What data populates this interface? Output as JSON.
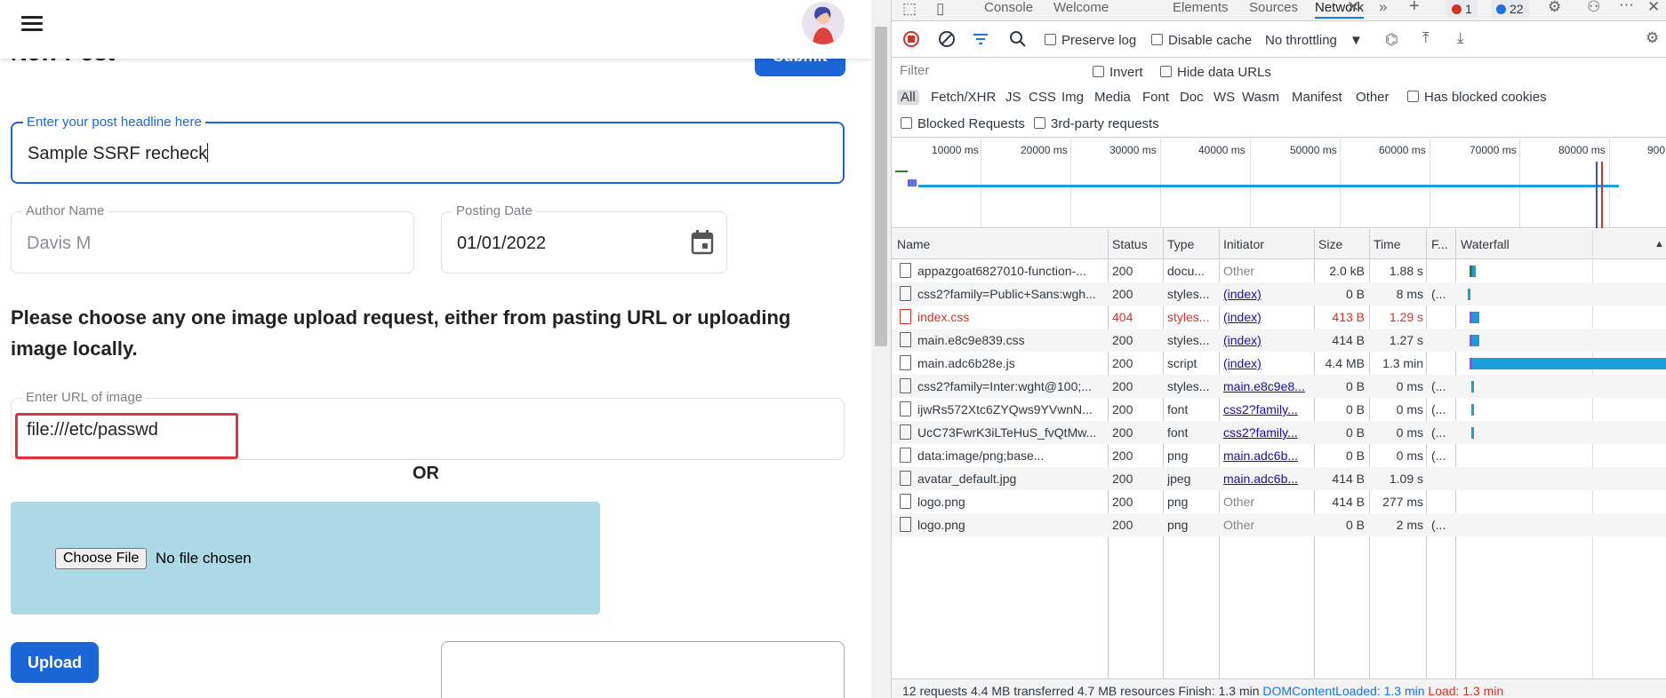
{
  "app": {
    "partial_heading": "New Post",
    "submit_label": "Submit",
    "headline": {
      "label": "Enter your post headline here",
      "value": "Sample SSRF recheck"
    },
    "author": {
      "label": "Author Name",
      "value": "Davis M"
    },
    "date": {
      "label": "Posting Date",
      "value": "01/01/2022"
    },
    "instruction": "Please choose any one image upload request, either from pasting URL or uploading image locally.",
    "url_field": {
      "label": "Enter URL of image",
      "value": "file:///etc/passwd"
    },
    "or_label": "OR",
    "file": {
      "button": "Choose File",
      "status": "No file chosen"
    },
    "upload_label": "Upload",
    "colors": {
      "primary": "#1b67d8",
      "drop_zone": "#add8e6",
      "highlight": "#d9363e"
    }
  },
  "devtools": {
    "tabs": [
      "Console",
      "Welcome",
      "Elements",
      "Sources",
      "Network"
    ],
    "active_tab": "Network",
    "error_count": "1",
    "message_count": "22",
    "toolbar": {
      "preserve_log": "Preserve log",
      "disable_cache": "Disable cache",
      "throttling": "No throttling"
    },
    "filter": {
      "placeholder": "Filter",
      "invert": "Invert",
      "hide_data_urls": "Hide data URLs",
      "types": [
        "All",
        "Fetch/XHR",
        "JS",
        "CSS",
        "Img",
        "Media",
        "Font",
        "Doc",
        "WS",
        "Wasm",
        "Manifest",
        "Other"
      ],
      "has_blocked_cookies": "Has blocked cookies",
      "blocked_requests": "Blocked Requests",
      "third_party": "3rd-party requests"
    },
    "timeline_ticks": [
      "10000 ms",
      "20000 ms",
      "30000 ms",
      "40000 ms",
      "50000 ms",
      "60000 ms",
      "70000 ms",
      "80000 ms",
      "900"
    ],
    "columns": [
      "Name",
      "Status",
      "Type",
      "Initiator",
      "Size",
      "Time",
      "F...",
      "Waterfall"
    ],
    "rows": [
      {
        "name": "appazgoat6827010-function-...",
        "status": "200",
        "type": "docu...",
        "initiator": "Other",
        "size": "2.0 kB",
        "time": "1.88 s",
        "fulfilled": ""
      },
      {
        "name": "css2?family=Public+Sans:wgh...",
        "status": "200",
        "type": "styles...",
        "initiator": "(index)",
        "size": "0 B",
        "time": "8 ms",
        "fulfilled": "(..."
      },
      {
        "name": "index.css",
        "status": "404",
        "type": "styles...",
        "initiator": "(index)",
        "size": "413 B",
        "time": "1.29 s",
        "fulfilled": ""
      },
      {
        "name": "main.e8c9e839.css",
        "status": "200",
        "type": "styles...",
        "initiator": "(index)",
        "size": "414 B",
        "time": "1.27 s",
        "fulfilled": ""
      },
      {
        "name": "main.adc6b28e.js",
        "status": "200",
        "type": "script",
        "initiator": "(index)",
        "size": "4.4 MB",
        "time": "1.3 min",
        "fulfilled": ""
      },
      {
        "name": "css2?family=Inter:wght@100;...",
        "status": "200",
        "type": "styles...",
        "initiator": "main.e8c9e8...",
        "size": "0 B",
        "time": "0 ms",
        "fulfilled": "(..."
      },
      {
        "name": "ijwRs572Xtc6ZYQws9YVwnN...",
        "status": "200",
        "type": "font",
        "initiator": "css2?family...",
        "size": "0 B",
        "time": "0 ms",
        "fulfilled": "(..."
      },
      {
        "name": "UcC73FwrK3iLTeHuS_fvQtMw...",
        "status": "200",
        "type": "font",
        "initiator": "css2?family...",
        "size": "0 B",
        "time": "0 ms",
        "fulfilled": "(..."
      },
      {
        "name": "data:image/png;base...",
        "status": "200",
        "type": "png",
        "initiator": "main.adc6b...",
        "size": "0 B",
        "time": "0 ms",
        "fulfilled": "(..."
      },
      {
        "name": "avatar_default.jpg",
        "status": "200",
        "type": "jpeg",
        "initiator": "main.adc6b...",
        "size": "414 B",
        "time": "1.09 s",
        "fulfilled": ""
      },
      {
        "name": "logo.png",
        "status": "200",
        "type": "png",
        "initiator": "Other",
        "size": "414 B",
        "time": "277 ms",
        "fulfilled": ""
      },
      {
        "name": "logo.png",
        "status": "200",
        "type": "png",
        "initiator": "Other",
        "size": "0 B",
        "time": "2 ms",
        "fulfilled": "(..."
      }
    ],
    "status_bar": {
      "summary": "12 requests  4.4 MB transferred  4.7 MB resources  Finish: 1.3 min",
      "dom_content_loaded": "DOMContentLoaded: 1.3 min",
      "load": "Load: 1.3 min"
    }
  }
}
